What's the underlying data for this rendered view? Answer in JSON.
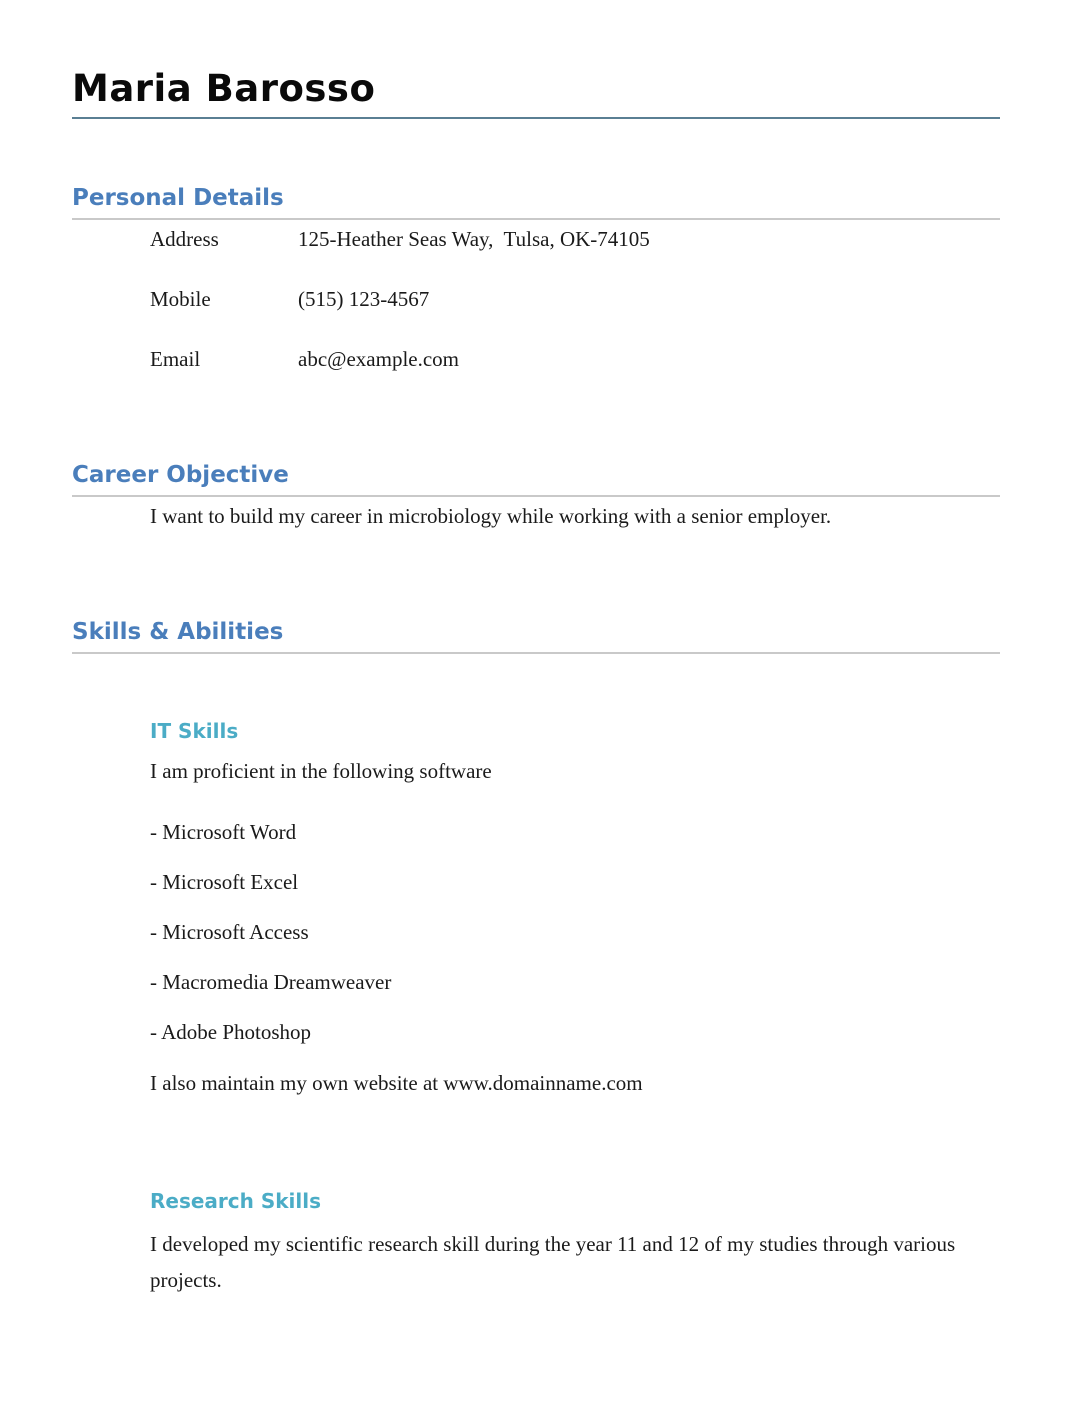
{
  "document": {
    "name": "Maria Barosso"
  },
  "sections": {
    "personal_details": {
      "title": "Personal Details",
      "rows": [
        {
          "label": "Address",
          "value": "125-Heather Seas Way,  Tulsa, OK-74105"
        },
        {
          "label": "Mobile",
          "value": "(515) 123-4567"
        },
        {
          "label": "Email",
          "value": "abc@example.com"
        }
      ]
    },
    "career_objective": {
      "title": "Career Objective",
      "text": "I want to build my career in microbiology while working with a senior employer."
    },
    "skills_abilities": {
      "title": "Skills & Abilities",
      "it_skills": {
        "title": "IT Skills",
        "intro": "I am proficient in the following software",
        "items": [
          "- Microsoft Word",
          "- Microsoft Excel",
          "- Microsoft Access",
          "- Macromedia Dreamweaver",
          "- Adobe Photoshop"
        ],
        "note": "I also maintain my own website at www.domainname.com"
      },
      "research_skills": {
        "title": "Research Skills",
        "text": "I developed my scientific research skill during the year 11 and 12 of my studies through various projects."
      }
    }
  },
  "colors": {
    "section_heading": "#4a7ebb",
    "sub_heading": "#4bacc6",
    "name_rule": "#5a7f93",
    "section_rule": "#c9c9c9",
    "body_text": "#1a1a1a"
  }
}
